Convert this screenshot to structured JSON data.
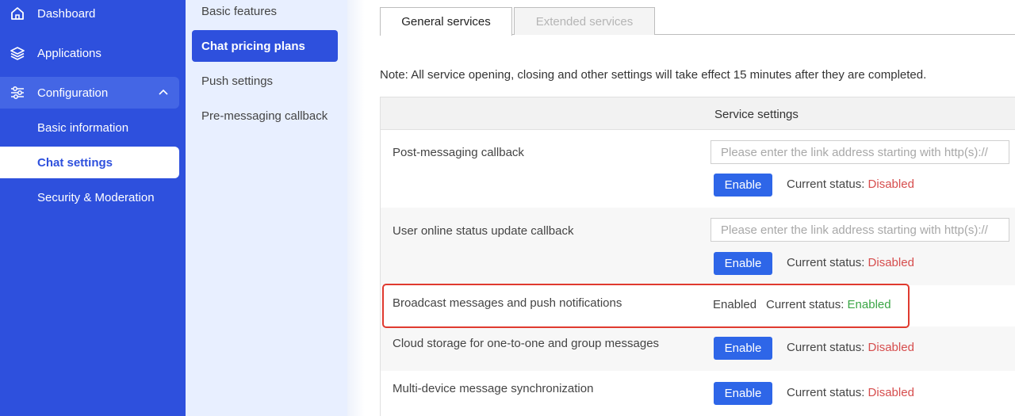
{
  "nav": {
    "dashboard": "Dashboard",
    "applications": "Applications",
    "configuration": "Configuration",
    "basic_information": "Basic information",
    "chat_settings": "Chat settings",
    "security_moderation": "Security & Moderation"
  },
  "subnav": {
    "basic_features": "Basic features",
    "chat_pricing_plans": "Chat pricing plans",
    "push_settings": "Push settings",
    "pre_messaging_callback": "Pre-messaging callback"
  },
  "tabs": {
    "general": "General services",
    "extended": "Extended services"
  },
  "note": "Note: All service opening, closing and other settings will take effect 15 minutes after they are completed.",
  "table": {
    "header": "Service settings",
    "rows": [
      {
        "name": "Post-messaging callback",
        "placeholder": "Please enter the link address starting with http(s)://",
        "button": "Enable",
        "status_label": "Current status:",
        "status_value": "Disabled"
      },
      {
        "name": "User online status update callback",
        "placeholder": "Please enter the link address starting with http(s)://",
        "button": "Enable",
        "status_label": "Current status:",
        "status_value": "Disabled"
      },
      {
        "name": "Broadcast messages and push notifications",
        "plain": "Enabled",
        "status_label": "Current status:",
        "status_value": "Enabled"
      },
      {
        "name": "Cloud storage for one-to-one and group messages",
        "button": "Enable",
        "status_label": "Current status:",
        "status_value": "Disabled"
      },
      {
        "name": "Multi-device message synchronization",
        "button": "Enable",
        "status_label": "Current status:",
        "status_value": "Disabled"
      }
    ]
  },
  "colors": {
    "nav_bg": "#2e50dd",
    "accent": "#2e66e8",
    "disabled": "#d64d4d",
    "enabled": "#3aa545",
    "highlight": "#e03a2f"
  },
  "icons": {
    "dashboard": "home-icon",
    "applications": "layers-icon",
    "configuration": "sliders-icon",
    "configuration_toggle": "chevron-up-icon"
  }
}
